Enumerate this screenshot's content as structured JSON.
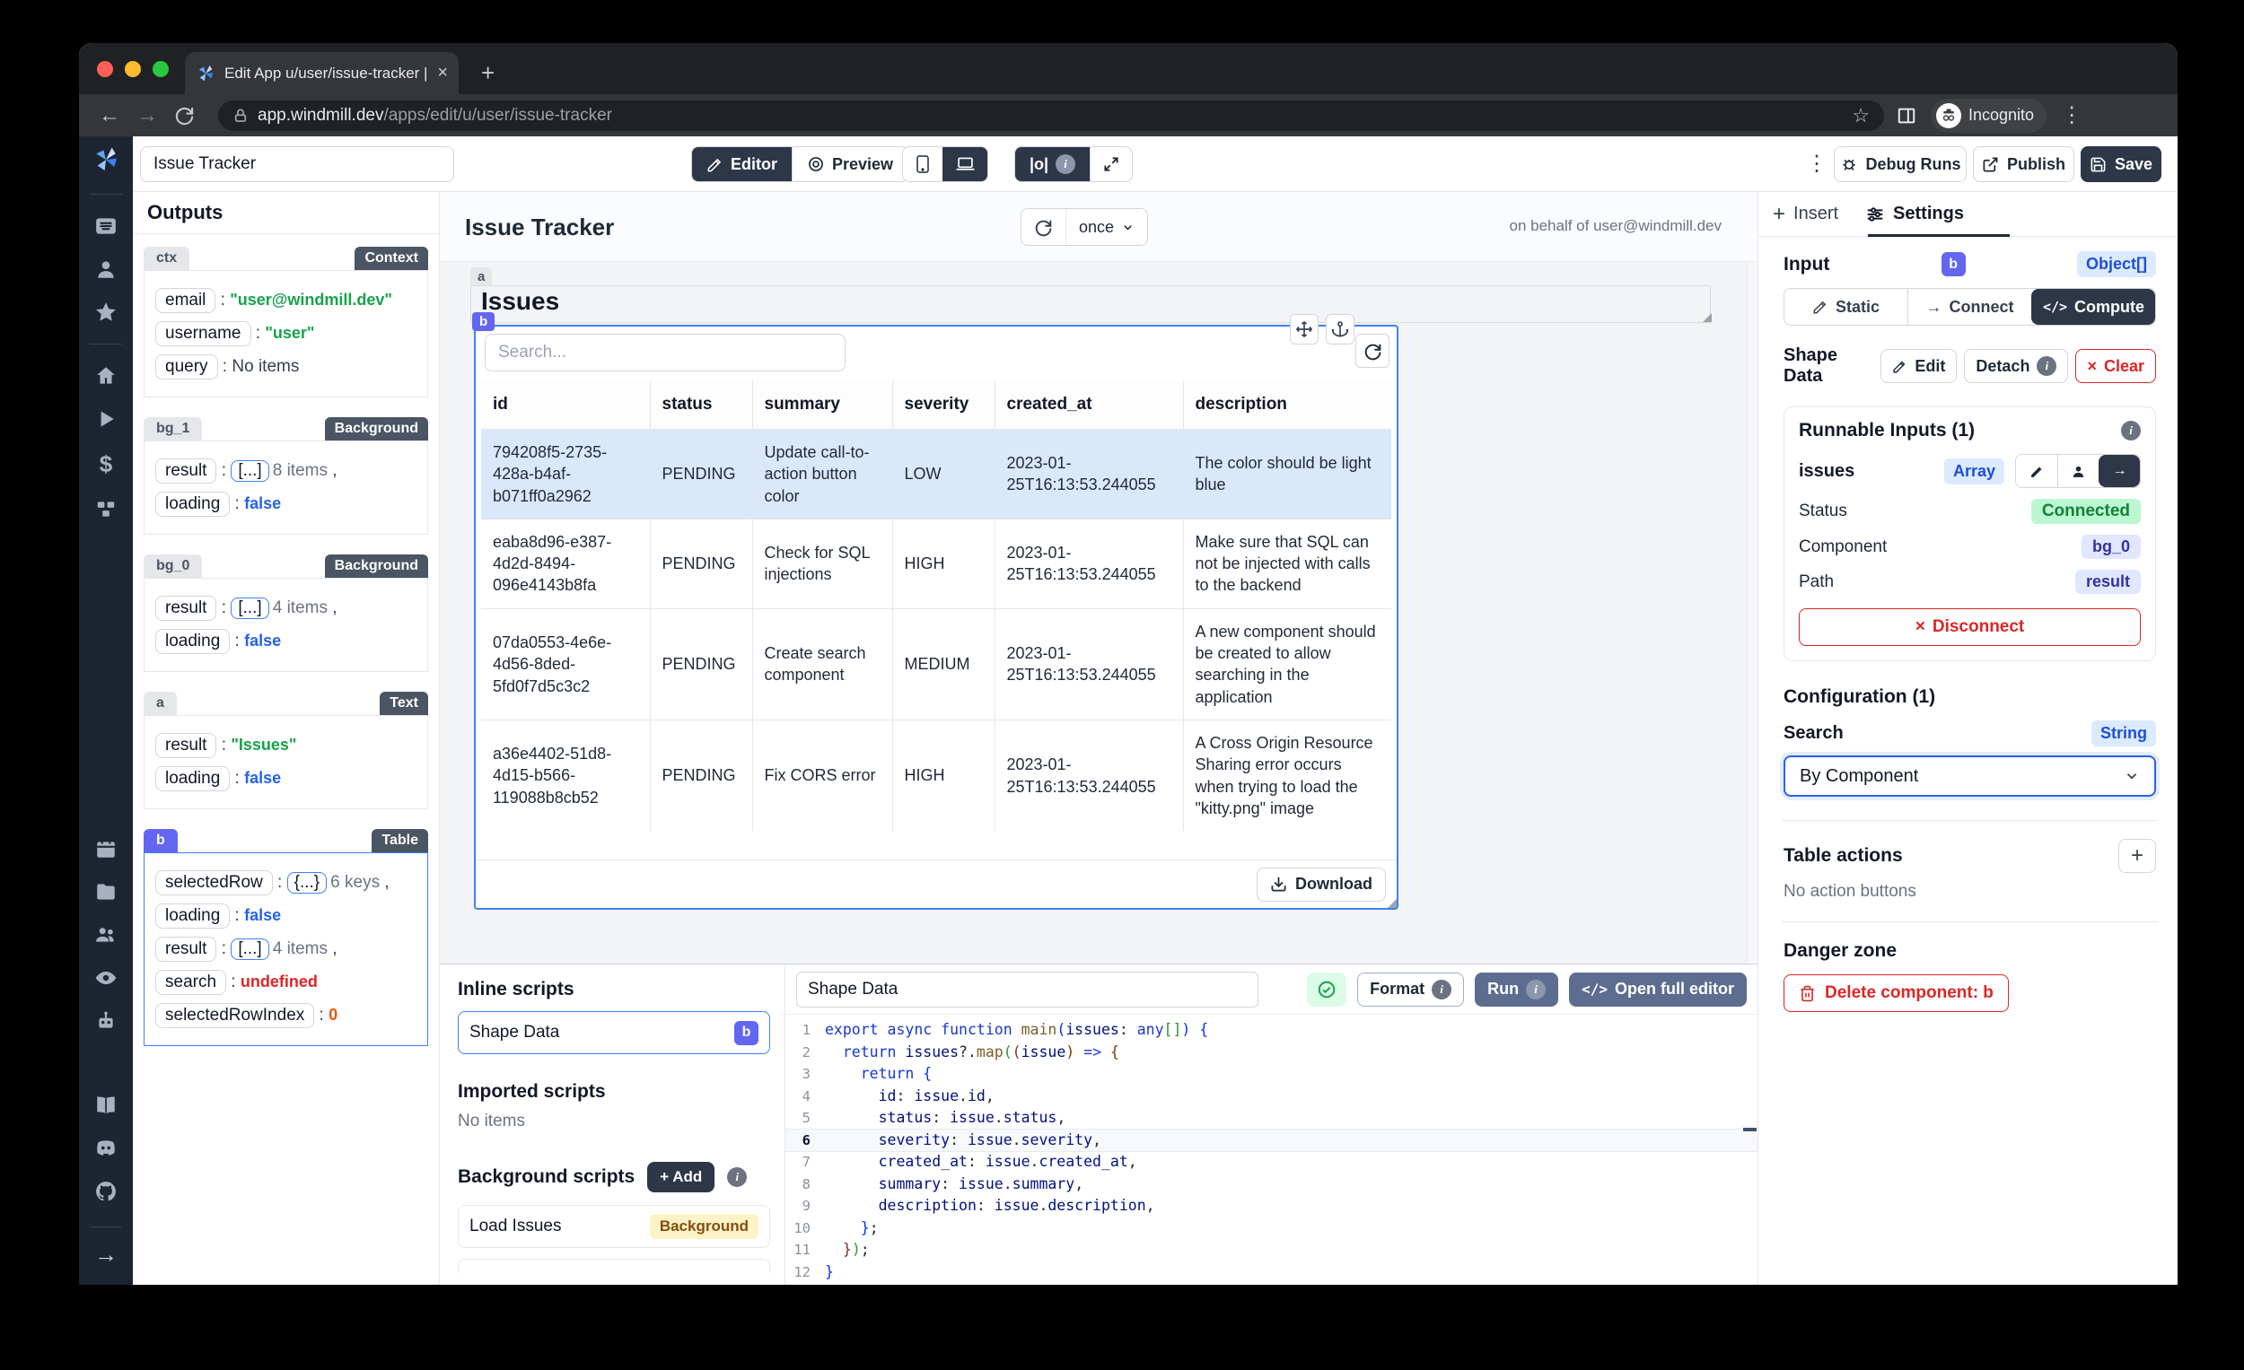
{
  "browser": {
    "tab_title": "Edit App u/user/issue-tracker |",
    "url_domain": "app.windmill.dev",
    "url_path": "/apps/edit/u/user/issue-tracker",
    "incognito_label": "Incognito"
  },
  "icons": {
    "close": "×",
    "new_tab": "+",
    "back": "←",
    "forward": "→",
    "menu": "⋮",
    "star": "☆",
    "pipe_o": "|o|",
    "cross": "×",
    "plus": "+",
    "dollar": "$",
    "arrow_right": "→",
    "info": "i",
    "code_slash": "</>"
  },
  "appbar": {
    "app_name": "Issue Tracker",
    "editor_label": "Editor",
    "preview_label": "Preview",
    "debug_runs_label": "Debug Runs",
    "publish_label": "Publish",
    "save_label": "Save"
  },
  "outputs": {
    "title": "Outputs",
    "cards": [
      {
        "tab": "ctx",
        "badge": "Context",
        "rows": [
          {
            "key": "email",
            "value": "\"user@windmill.dev\"",
            "vcls": "green"
          },
          {
            "key": "username",
            "value": "\"user\"",
            "vcls": "green"
          },
          {
            "key": "query",
            "value": "No items",
            "vcls": "plain"
          }
        ]
      },
      {
        "tab": "bg_1",
        "badge": "Background",
        "rows": [
          {
            "key": "result",
            "bracket": "[...]",
            "value": "8 items",
            "vcls": "muted",
            "comma": true
          },
          {
            "key": "loading",
            "value": "false",
            "vcls": "blue"
          }
        ]
      },
      {
        "tab": "bg_0",
        "badge": "Background",
        "rows": [
          {
            "key": "result",
            "bracket": "[...]",
            "value": "4 items",
            "vcls": "muted",
            "comma": true
          },
          {
            "key": "loading",
            "value": "false",
            "vcls": "blue"
          }
        ]
      },
      {
        "tab": "a",
        "badge": "Text",
        "rows": [
          {
            "key": "result",
            "value": "\"Issues\"",
            "vcls": "green"
          },
          {
            "key": "loading",
            "value": "false",
            "vcls": "blue"
          }
        ]
      },
      {
        "tab": "b",
        "badge": "Table",
        "purple": true,
        "selected": true,
        "rows": [
          {
            "key": "selectedRow",
            "bracket": "{...}",
            "value": "6 keys",
            "vcls": "muted",
            "comma": true
          },
          {
            "key": "loading",
            "value": "false",
            "vcls": "blue"
          },
          {
            "key": "result",
            "bracket": "[...]",
            "value": "4 items",
            "vcls": "muted",
            "comma": true
          },
          {
            "key": "search",
            "value": "undefined",
            "vcls": "red"
          },
          {
            "key": "selectedRowIndex",
            "value": "0",
            "vcls": "orange"
          }
        ]
      }
    ]
  },
  "canvas": {
    "title": "Issue Tracker",
    "schedule": "once",
    "on_behalf": "on behalf of user@windmill.dev",
    "text_component": {
      "tag": "a",
      "text": "Issues"
    },
    "table": {
      "tag": "b",
      "search_placeholder": "Search...",
      "columns": [
        "id",
        "status",
        "summary",
        "severity",
        "created_at",
        "description"
      ],
      "rows": [
        [
          "794208f5-2735-428a-b4af-b071ff0a2962",
          "PENDING",
          "Update call-to-action button color",
          "LOW",
          "2023-01-25T16:13:53.244055",
          "The color should be light blue"
        ],
        [
          "eaba8d96-e387-4d2d-8494-096e4143b8fa",
          "PENDING",
          "Check for SQL injections",
          "HIGH",
          "2023-01-25T16:13:53.244055",
          "Make sure that SQL can not be injected with calls to the backend"
        ],
        [
          "07da0553-4e6e-4d56-8ded-5fd0f7d5c3c2",
          "PENDING",
          "Create search component",
          "MEDIUM",
          "2023-01-25T16:13:53.244055",
          "A new component should be created to allow searching in the application"
        ],
        [
          "a36e4402-51d8-4d15-b566-119088b8cb52",
          "PENDING",
          "Fix CORS error",
          "HIGH",
          "2023-01-25T16:13:53.244055",
          "A Cross Origin Resource Sharing error occurs when trying to load the \"kitty.png\" image"
        ]
      ],
      "selected_row_index": 0,
      "download_label": "Download"
    }
  },
  "scripts": {
    "inline_title": "Inline scripts",
    "inline_items": [
      {
        "label": "Shape Data",
        "badge": "b"
      }
    ],
    "imported_title": "Imported scripts",
    "imported_empty": "No items",
    "background_title": "Background scripts",
    "add_label": "+ Add",
    "background_items": [
      {
        "label": "Load Issues",
        "badge": "Background"
      }
    ]
  },
  "editor": {
    "name": "Shape Data",
    "format_label": "Format",
    "run_label": "Run",
    "open_full_label": "Open full editor",
    "active_line": 6,
    "code_lines": [
      {
        "n": 1,
        "seg": [
          [
            "kw",
            "export"
          ],
          [
            "pl",
            " "
          ],
          [
            "kw",
            "async"
          ],
          [
            "pl",
            " "
          ],
          [
            "kw",
            "function"
          ],
          [
            "fn",
            " main"
          ],
          [
            "b1",
            "("
          ],
          [
            "vr",
            "issues"
          ],
          [
            "pl",
            ": "
          ],
          [
            "kw",
            "any"
          ],
          [
            "b2",
            "[]"
          ],
          [
            "b1",
            ")"
          ],
          [
            "pl",
            " "
          ],
          [
            "b1",
            "{"
          ]
        ]
      },
      {
        "n": 2,
        "seg": [
          [
            "pl",
            "  "
          ],
          [
            "kw",
            "return"
          ],
          [
            "pl",
            " "
          ],
          [
            "vr",
            "issues"
          ],
          [
            "pl",
            "?."
          ],
          [
            "fn",
            "map"
          ],
          [
            "b2",
            "("
          ],
          [
            "b3",
            "("
          ],
          [
            "vr",
            "issue"
          ],
          [
            "b3",
            ")"
          ],
          [
            "pl",
            " "
          ],
          [
            "kw",
            "=>"
          ],
          [
            "pl",
            " "
          ],
          [
            "b3",
            "{"
          ]
        ]
      },
      {
        "n": 3,
        "seg": [
          [
            "pl",
            "    "
          ],
          [
            "kw",
            "return"
          ],
          [
            "pl",
            " "
          ],
          [
            "b1",
            "{"
          ]
        ]
      },
      {
        "n": 4,
        "seg": [
          [
            "pl",
            "      "
          ],
          [
            "vr",
            "id"
          ],
          [
            "pl",
            ": "
          ],
          [
            "vr",
            "issue"
          ],
          [
            "pl",
            "."
          ],
          [
            "vr",
            "id"
          ],
          [
            "pl",
            ","
          ]
        ]
      },
      {
        "n": 5,
        "seg": [
          [
            "pl",
            "      "
          ],
          [
            "vr",
            "status"
          ],
          [
            "pl",
            ": "
          ],
          [
            "vr",
            "issue"
          ],
          [
            "pl",
            "."
          ],
          [
            "vr",
            "status"
          ],
          [
            "pl",
            ","
          ]
        ]
      },
      {
        "n": 6,
        "seg": [
          [
            "pl",
            "      "
          ],
          [
            "vr",
            "severity"
          ],
          [
            "pl",
            ": "
          ],
          [
            "vr",
            "issue"
          ],
          [
            "pl",
            "."
          ],
          [
            "vr",
            "severity"
          ],
          [
            "pl",
            ","
          ]
        ]
      },
      {
        "n": 7,
        "seg": [
          [
            "pl",
            "      "
          ],
          [
            "vr",
            "created_at"
          ],
          [
            "pl",
            ": "
          ],
          [
            "vr",
            "issue"
          ],
          [
            "pl",
            "."
          ],
          [
            "vr",
            "created_at"
          ],
          [
            "pl",
            ","
          ]
        ]
      },
      {
        "n": 8,
        "seg": [
          [
            "pl",
            "      "
          ],
          [
            "vr",
            "summary"
          ],
          [
            "pl",
            ": "
          ],
          [
            "vr",
            "issue"
          ],
          [
            "pl",
            "."
          ],
          [
            "vr",
            "summary"
          ],
          [
            "pl",
            ","
          ]
        ]
      },
      {
        "n": 9,
        "seg": [
          [
            "pl",
            "      "
          ],
          [
            "vr",
            "description"
          ],
          [
            "pl",
            ": "
          ],
          [
            "vr",
            "issue"
          ],
          [
            "pl",
            "."
          ],
          [
            "vr",
            "description"
          ],
          [
            "pl",
            ","
          ]
        ]
      },
      {
        "n": 10,
        "seg": [
          [
            "pl",
            "    "
          ],
          [
            "b1",
            "}"
          ],
          [
            "pl",
            ";"
          ]
        ]
      },
      {
        "n": 11,
        "seg": [
          [
            "pl",
            "  "
          ],
          [
            "b3",
            "}"
          ],
          [
            "b2",
            ")"
          ],
          [
            "pl",
            ";"
          ]
        ]
      },
      {
        "n": 12,
        "seg": [
          [
            "b1",
            "}"
          ]
        ]
      }
    ]
  },
  "panel": {
    "insert_tab": "Insert",
    "settings_tab": "Settings",
    "input_label": "Input",
    "input_tag": "b",
    "input_type": "Object[]",
    "static_label": "Static",
    "connect_label": "Connect",
    "compute_label": "Compute",
    "shape_data_label": "Shape Data",
    "edit_label": "Edit",
    "detach_label": "Detach",
    "clear_label": "Clear",
    "runnable_title": "Runnable Inputs (1)",
    "issues_label": "issues",
    "issues_type": "Array",
    "status_label": "Status",
    "status_value": "Connected",
    "component_label": "Component",
    "component_value": "bg_0",
    "path_label": "Path",
    "path_value": "result",
    "disconnect_label": "Disconnect",
    "config_title": "Configuration (1)",
    "search_label": "Search",
    "search_type": "String",
    "search_value": "By Component",
    "table_actions_title": "Table actions",
    "table_actions_empty": "No action buttons",
    "danger_title": "Danger zone",
    "delete_label": "Delete component: b"
  },
  "sidebar": {
    "icons": [
      "windmill-logo",
      "apps",
      "person",
      "star",
      "home",
      "play",
      "dollar",
      "hub",
      "calendar",
      "folder",
      "users",
      "eye",
      "robot",
      "book",
      "discord",
      "github",
      "collapse-arrow"
    ]
  },
  "colors": {
    "accent_indigo": "#6366f1",
    "dark_slate": "#2d3748",
    "steel_blue": "#5d6d90",
    "selection_blue": "#3b82f6",
    "danger_red": "#dc2626",
    "connected_green_bg": "#bbf7d0",
    "badge_blue_bg": "#dbeafe",
    "selected_row_bg": "#d9e8fb",
    "background_badge_bg": "#fef3c7"
  }
}
